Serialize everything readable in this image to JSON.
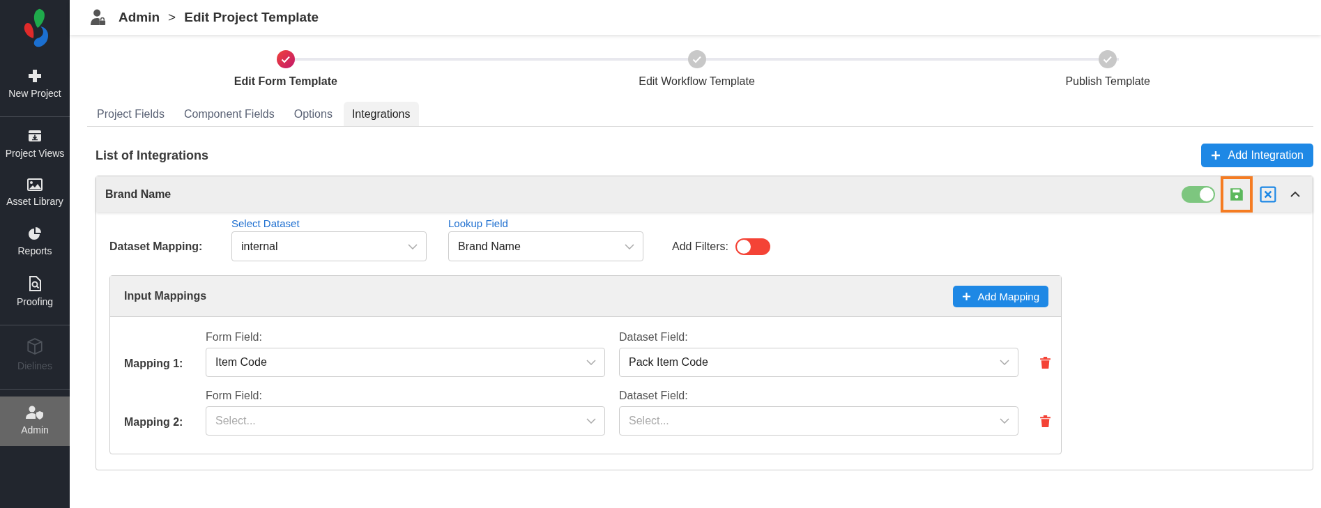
{
  "sidebar": {
    "groups": [
      {
        "items": [
          {
            "label": "New Project",
            "selected": false,
            "disabled": false
          }
        ]
      },
      {
        "items": [
          {
            "label": "Project Views",
            "selected": false,
            "disabled": false
          },
          {
            "label": "Asset Library",
            "selected": false,
            "disabled": false
          },
          {
            "label": "Reports",
            "selected": false,
            "disabled": false
          },
          {
            "label": "Proofing",
            "selected": false,
            "disabled": false
          }
        ]
      },
      {
        "items": [
          {
            "label": "Dielines",
            "selected": false,
            "disabled": true
          }
        ]
      },
      {
        "items": [
          {
            "label": "Admin",
            "selected": true,
            "disabled": false
          }
        ]
      }
    ]
  },
  "header": {
    "breadcrumb": [
      "Admin",
      "Edit Project Template"
    ],
    "separator": ">"
  },
  "stepper": [
    {
      "label": "Edit Form Template",
      "active": true
    },
    {
      "label": "Edit Workflow Template",
      "active": false
    },
    {
      "label": "Publish Template",
      "active": false
    }
  ],
  "tabs": [
    {
      "label": "Project Fields",
      "selected": false
    },
    {
      "label": "Component Fields",
      "selected": false
    },
    {
      "label": "Options",
      "selected": false
    },
    {
      "label": "Integrations",
      "selected": true
    }
  ],
  "section_title": "List of Integrations",
  "add_button": "Add Integration",
  "integration": {
    "title": "Brand Name",
    "enabled": true,
    "save_highlighted": true,
    "expanded": true,
    "dataset_mapping": {
      "label": "Dataset Mapping:",
      "select_dataset": {
        "label": "Select Dataset",
        "value": "internal"
      },
      "lookup_field": {
        "label": "Lookup Field",
        "value": "Brand Name"
      },
      "filters": {
        "label": "Add Filters:",
        "on": false
      }
    },
    "input_mappings": {
      "title": "Input Mappings",
      "add_button": "Add Mapping",
      "rows": [
        {
          "label": "Mapping 1:",
          "form_field": {
            "label": "Form Field:",
            "value": "Item Code"
          },
          "dataset_field": {
            "label": "Dataset Field:",
            "value": "Pack Item Code"
          }
        },
        {
          "label": "Mapping 2:",
          "form_field": {
            "label": "Form Field:",
            "placeholder": "Select..."
          },
          "dataset_field": {
            "label": "Dataset Field:",
            "placeholder": "Select..."
          }
        }
      ]
    }
  }
}
